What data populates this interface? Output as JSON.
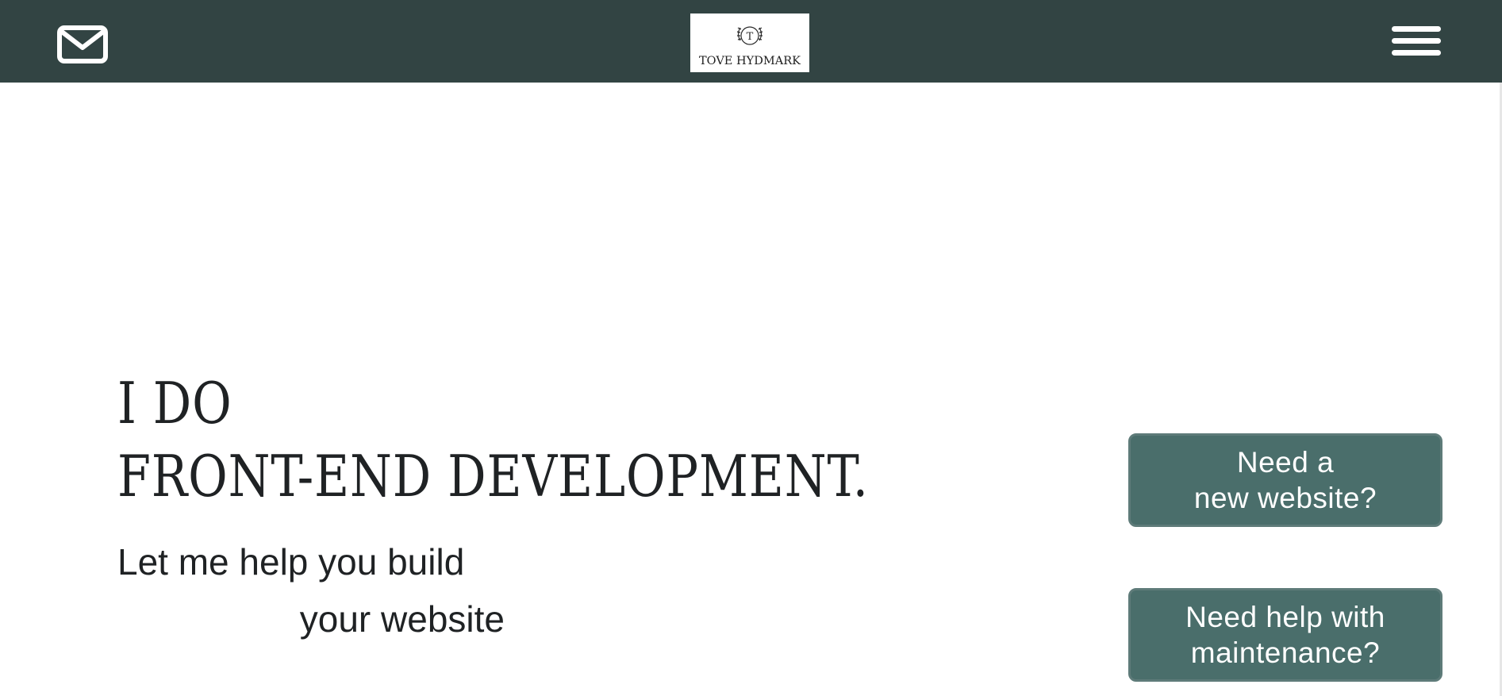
{
  "header": {
    "mail_icon": "envelope-icon",
    "logo": {
      "monogram": "T",
      "name": "TOVE HYDMARK"
    },
    "menu_icon": "hamburger-menu-icon",
    "background_color": "#324443"
  },
  "hero": {
    "headline_line1": "I DO",
    "headline_line2": "FRONT-END DEVELOPMENT.",
    "subline_line1": "Let me help you build",
    "subline_line2": "your website"
  },
  "cta": {
    "new_website": {
      "line1": "Need a",
      "line2": "new website?"
    },
    "maintenance": {
      "line1": "Need help with",
      "line2": "maintenance?"
    },
    "button_color": "#4a6e6b"
  }
}
